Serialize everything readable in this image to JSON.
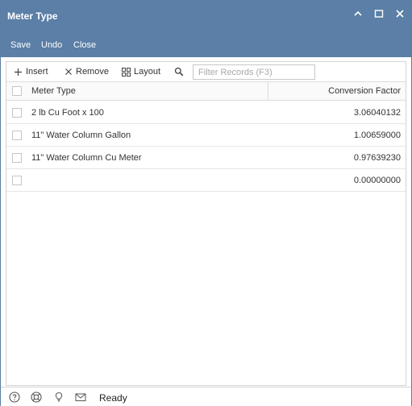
{
  "window": {
    "title": "Meter Type",
    "controls": [
      "chevron-up-icon",
      "maximize-icon",
      "close-icon"
    ]
  },
  "menu": {
    "save": "Save",
    "undo": "Undo",
    "close": "Close"
  },
  "toolbar": {
    "insert": "Insert",
    "remove": "Remove",
    "layout": "Layout",
    "filter_placeholder": "Filter Records (F3)"
  },
  "grid": {
    "columns": [
      "Meter Type",
      "Conversion Factor"
    ],
    "rows": [
      {
        "meter_type": "2 lb Cu Foot x 100",
        "conversion_factor": "3.06040132"
      },
      {
        "meter_type": "11\" Water Column Gallon",
        "conversion_factor": "1.00659000"
      },
      {
        "meter_type": "11\" Water Column Cu Meter",
        "conversion_factor": "0.97639230"
      },
      {
        "meter_type": "",
        "conversion_factor": "0.00000000"
      }
    ]
  },
  "status": {
    "text": "Ready",
    "icons": [
      "help-icon",
      "support-icon",
      "lightbulb-icon",
      "mail-icon"
    ]
  },
  "colors": {
    "titlebar": "#5b7fa6",
    "border": "#d3d3d3"
  }
}
